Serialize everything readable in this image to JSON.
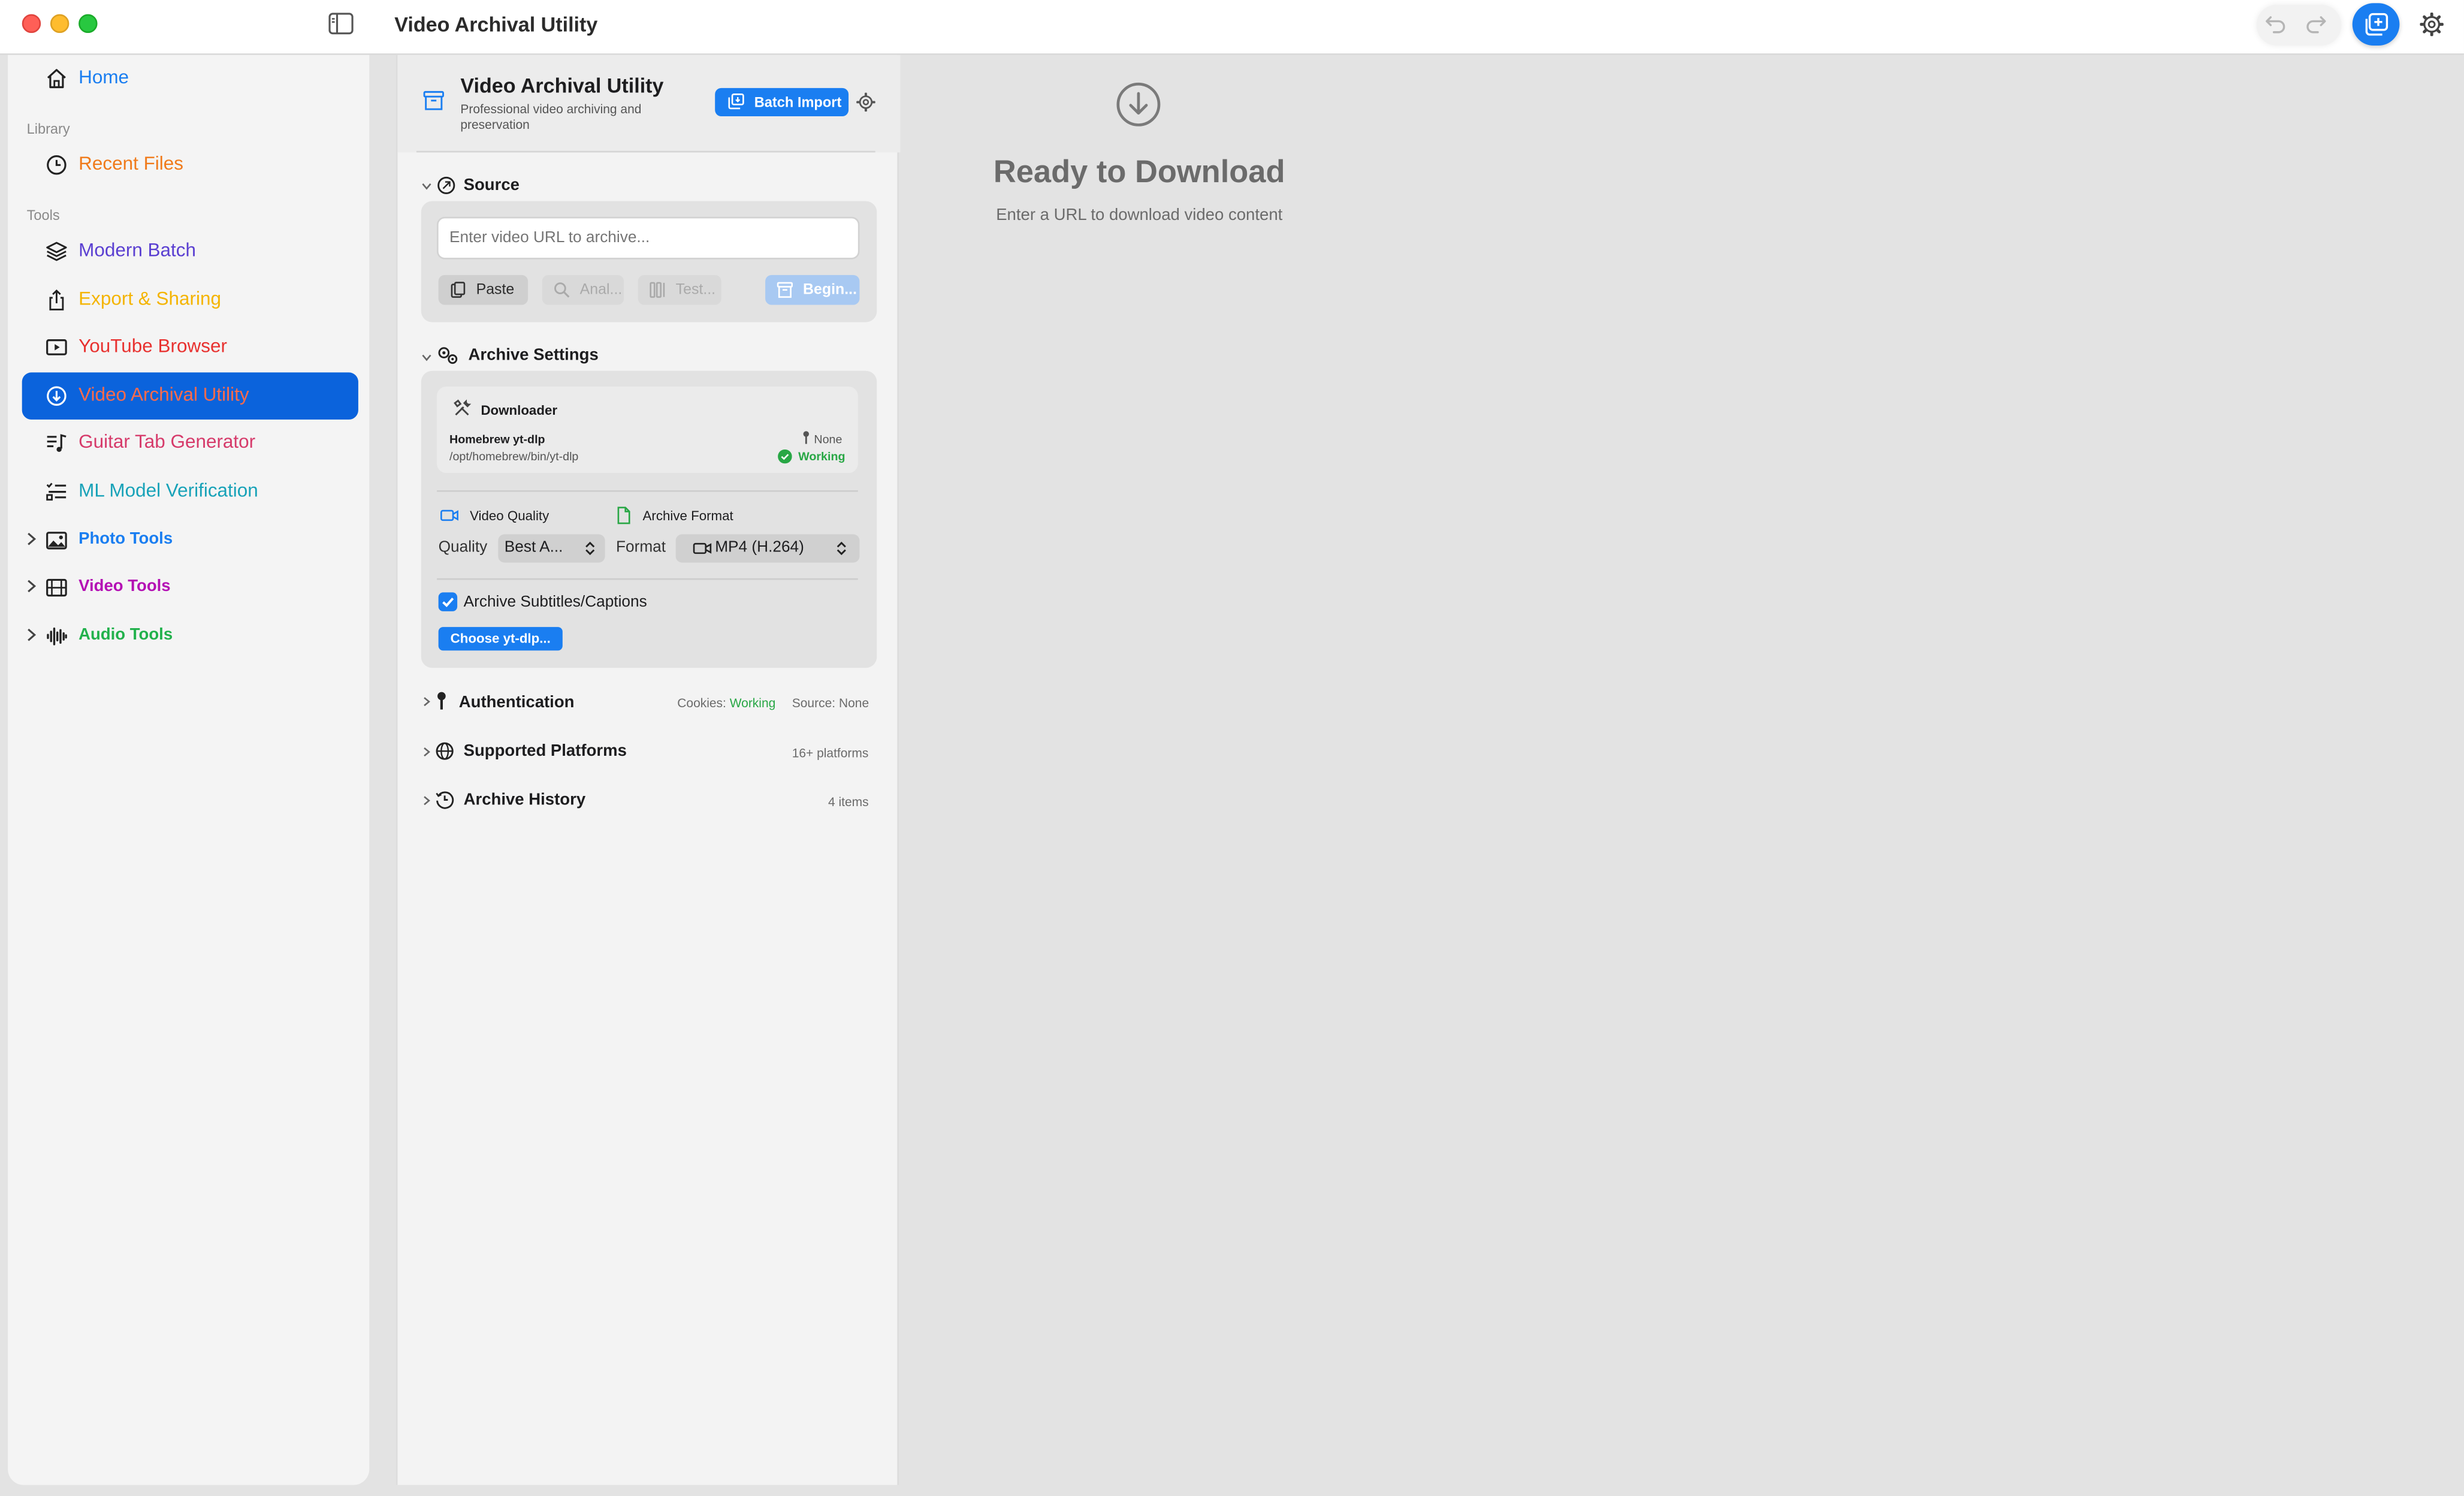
{
  "window": {
    "title": "Video Archival Utility"
  },
  "sidebar": {
    "home": "Home",
    "sections": {
      "library": "Library",
      "tools": "Tools"
    },
    "items": [
      {
        "label": "Recent Files",
        "color": "#f07a1a"
      },
      {
        "label": "Modern Batch",
        "color": "#5a3fd1"
      },
      {
        "label": "Export & Sharing",
        "color": "#f4b400"
      },
      {
        "label": "YouTube Browser",
        "color": "#e8312f"
      },
      {
        "label": "Video Archival Utility",
        "color": "#ff6b4a",
        "active": true
      },
      {
        "label": "Guitar Tab Generator",
        "color": "#d63a6a"
      },
      {
        "label": "ML Model Verification",
        "color": "#17a2b8"
      }
    ],
    "groups": [
      {
        "label": "Photo Tools",
        "color": "#1a7ef1"
      },
      {
        "label": "Video Tools",
        "color": "#b40fb4"
      },
      {
        "label": "Audio Tools",
        "color": "#22b14c"
      }
    ]
  },
  "panel": {
    "title": "Video Archival Utility",
    "subtitle": "Professional video archiving and preservation",
    "batch_import": "Batch Import",
    "source": {
      "title": "Source",
      "url_placeholder": "Enter video URL to archive...",
      "paste": "Paste",
      "analyze": "Anal...",
      "test": "Test...",
      "begin": "Begin..."
    },
    "archive_settings": {
      "title": "Archive Settings",
      "downloader_title": "Downloader",
      "downloader_name": "Homebrew yt-dlp",
      "downloader_path": "/opt/homebrew/bin/yt-dlp",
      "auth_state": "None",
      "status": "Working",
      "video_quality": "Video Quality",
      "archive_format": "Archive Format",
      "quality_label": "Quality",
      "quality_value": "Best A...",
      "format_label": "Format",
      "format_value": "MP4 (H.264)",
      "subtitles_label": "Archive Subtitles/Captions",
      "subtitles_checked": true,
      "choose_button": "Choose yt-dlp..."
    },
    "authentication": {
      "title": "Authentication",
      "cookies_label": "Cookies:",
      "cookies_value": "Working",
      "source_label": "Source:",
      "source_value": "None"
    },
    "platforms": {
      "title": "Supported Platforms",
      "count": "16+ platforms"
    },
    "history": {
      "title": "Archive History",
      "count": "4 items"
    }
  },
  "content": {
    "title": "Ready to Download",
    "subtitle": "Enter a URL to download video content"
  }
}
